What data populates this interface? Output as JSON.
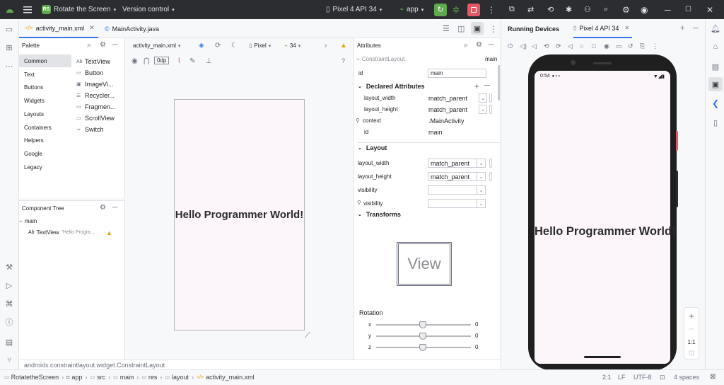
{
  "titlebar": {
    "project_badge": "RS",
    "project_name": "Rotate the Screen",
    "vcs": "Version control",
    "device": "Pixel 4 API 34",
    "run_config": "app"
  },
  "editor_tabs": [
    {
      "label": "activity_main.xml",
      "active": true
    },
    {
      "label": "MainActivity.java",
      "active": false
    }
  ],
  "palette": {
    "title": "Palette",
    "categories": [
      "Common",
      "Text",
      "Buttons",
      "Widgets",
      "Layouts",
      "Containers",
      "Helpers",
      "Google",
      "Legacy"
    ],
    "items": [
      "TextView",
      "Button",
      "ImageVi...",
      "Recycler...",
      "Fragmen...",
      "ScrollView",
      "Switch"
    ],
    "textview_prefix": "Ab"
  },
  "component_tree": {
    "title": "Component Tree",
    "root": "main",
    "child_prefix": "Ab",
    "child": "TextView",
    "child_hint": "\"Hello Progra..."
  },
  "design_toolbar": {
    "file": "activity_main.xml",
    "device": "Pixel",
    "api": "34",
    "margin": "0dp"
  },
  "design_preview": {
    "text": "Hello Programmer World!"
  },
  "attributes": {
    "title": "Attributes",
    "class": "ConstraintLayout",
    "class_id": "main",
    "id_label": "id",
    "id_value": "main",
    "declared_title": "Declared Attributes",
    "declared": [
      {
        "name": "layout_width",
        "value": "match_parent"
      },
      {
        "name": "layout_height",
        "value": "match_parent"
      },
      {
        "name": "context",
        "value": ".MainActivity"
      },
      {
        "name": "id",
        "value": "main"
      }
    ],
    "layout_title": "Layout",
    "layout": [
      {
        "name": "layout_width",
        "value": "match_parent"
      },
      {
        "name": "layout_height",
        "value": "match_parent"
      },
      {
        "name": "visibility",
        "value": ""
      },
      {
        "name": "visibility",
        "value": ""
      }
    ],
    "transforms_title": "Transforms",
    "view_label": "View",
    "rotation_title": "Rotation",
    "rotation": [
      {
        "axis": "x",
        "value": "0"
      },
      {
        "axis": "y",
        "value": "0"
      },
      {
        "axis": "z",
        "value": "0"
      }
    ]
  },
  "running_devices": {
    "title": "Running Devices",
    "tab": "Pixel 4 API 34",
    "clock": "0:54",
    "text": "Hello Programmer World!",
    "zoom_fit": "1:1"
  },
  "path_hint": "androidx.constraintlayout.widget.ConstraintLayout",
  "breadcrumb": [
    "RotatetheScreen",
    "app",
    "src",
    "main",
    "res",
    "layout",
    "activity_main.xml"
  ],
  "status": {
    "position": "2:1",
    "line_sep": "LF",
    "encoding": "UTF-8",
    "indent": "4 spaces"
  },
  "colors": {
    "accent": "#3574f0",
    "run_green": "#5fa84d",
    "stop_red": "#e55765",
    "warning": "#e5a50a",
    "preview_bg": "#fcf6fb"
  }
}
